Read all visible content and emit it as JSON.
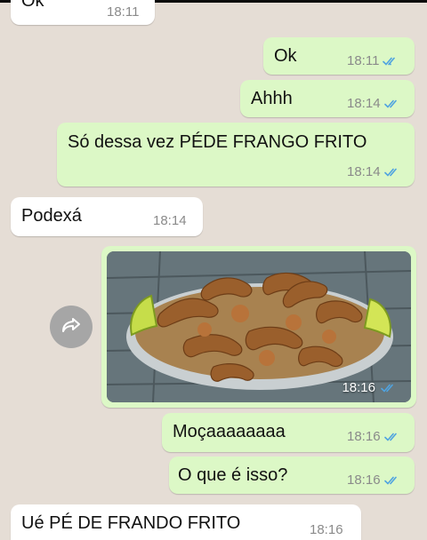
{
  "colors": {
    "chat_background": "#e5ddd5",
    "incoming_bubble": "#ffffff",
    "outgoing_bubble": "#dcf8c6",
    "read_tick": "#4fa3e0"
  },
  "messages": [
    {
      "text": "Ok",
      "time": "18:11",
      "direction": "incoming"
    },
    {
      "text": "Ok",
      "time": "18:11",
      "direction": "outgoing",
      "status": "read"
    },
    {
      "text": "Ahhh",
      "time": "18:14",
      "direction": "outgoing",
      "status": "read"
    },
    {
      "text": "Só dessa vez PÉDE FRANGO FRITO",
      "time": "18:14",
      "direction": "outgoing",
      "status": "read"
    },
    {
      "text": "Podexá",
      "time": "18:14",
      "direction": "incoming"
    },
    {
      "type": "image",
      "image_subject": "fried chicken feet",
      "time": "18:16",
      "direction": "outgoing",
      "status": "read"
    },
    {
      "text": "Moçaaaaaaaa",
      "time": "18:16",
      "direction": "outgoing",
      "status": "read"
    },
    {
      "text": "O que é isso?",
      "time": "18:16",
      "direction": "outgoing",
      "status": "read"
    },
    {
      "text": "Ué PÉ DE FRANDO FRITO",
      "time": "18:16",
      "direction": "incoming"
    }
  ],
  "icons": {
    "forward": "forward-arrow-icon",
    "read_receipt": "double-check-icon"
  }
}
